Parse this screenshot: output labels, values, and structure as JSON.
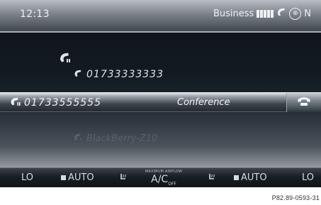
{
  "status_bar": {
    "time": "12:13",
    "network": "Business",
    "network_suffix": "N"
  },
  "calls": {
    "held_number": "01733333333",
    "active_number": "01733555555",
    "active_action": "Conference"
  },
  "device": {
    "name": "BlackBerry-Z10"
  },
  "climate": {
    "left_fan": "LO",
    "left_auto": "AUTO",
    "ac_caption": "MAXIMUM AIRFLOW",
    "ac_label": "A/C",
    "ac_sub": "OFF",
    "right_auto": "AUTO",
    "right_fan": "LO"
  },
  "figure": {
    "reference": "P82.89-0593-31"
  },
  "colors": {
    "screen_bg": "#131b22",
    "highlight_bar": "#9ea5ab",
    "text_light": "#eef1f3"
  },
  "icons": {
    "status": [
      "signal-strength-icon",
      "phone-icon",
      "globe-icon"
    ],
    "calls": [
      "phone-held-icon",
      "phone-icon",
      "phone-active-icon",
      "hang-up-icon",
      "bluetooth-phone-icon"
    ],
    "climate": [
      "seat-heating-icon",
      "seat-heating-icon"
    ]
  }
}
